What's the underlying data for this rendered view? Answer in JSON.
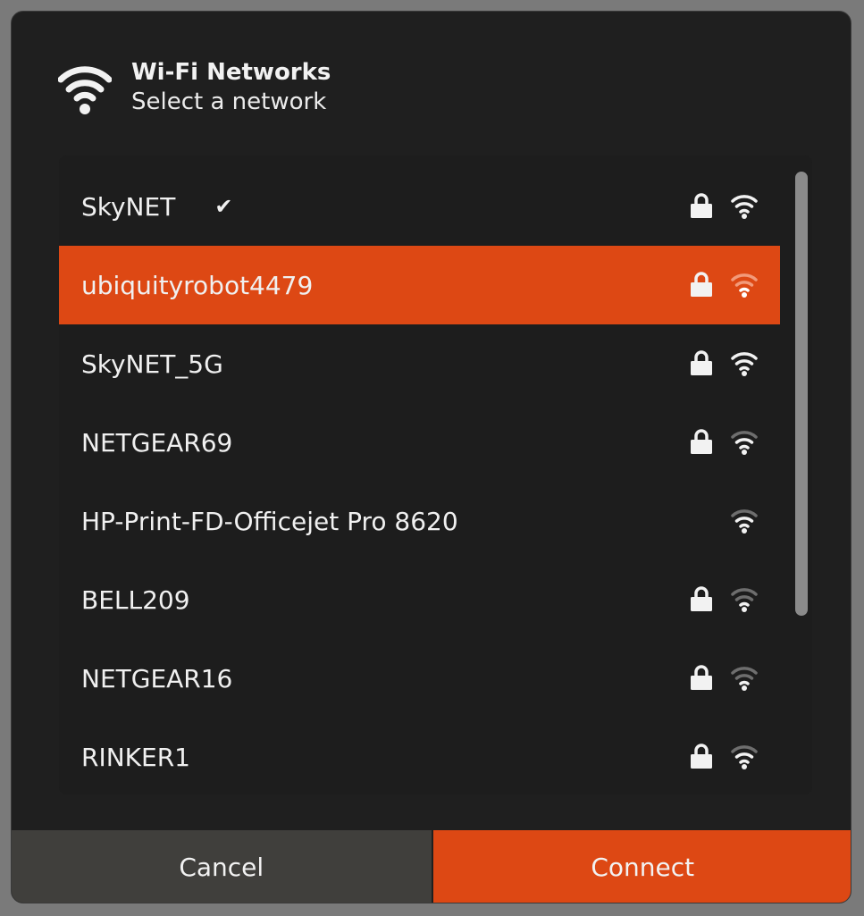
{
  "header": {
    "title": "Wi-Fi Networks",
    "subtitle": "Select a network",
    "icon": "wifi-icon"
  },
  "networks": [
    {
      "name": "SkyNET",
      "connected": true,
      "secured": true,
      "signal": 3,
      "selected": false
    },
    {
      "name": "ubiquityrobot4479",
      "connected": false,
      "secured": true,
      "signal": 1,
      "selected": true
    },
    {
      "name": "SkyNET_5G",
      "connected": false,
      "secured": true,
      "signal": 3,
      "selected": false
    },
    {
      "name": "NETGEAR69",
      "connected": false,
      "secured": true,
      "signal": 2,
      "selected": false
    },
    {
      "name": "HP-Print-FD-Officejet Pro 8620",
      "connected": false,
      "secured": false,
      "signal": 2,
      "selected": false
    },
    {
      "name": "BELL209",
      "connected": false,
      "secured": true,
      "signal": 1,
      "selected": false
    },
    {
      "name": "NETGEAR16",
      "connected": false,
      "secured": true,
      "signal": 1,
      "selected": false
    },
    {
      "name": "RINKER1",
      "connected": false,
      "secured": true,
      "signal": 2,
      "selected": false
    }
  ],
  "check_glyph": "✔",
  "buttons": {
    "cancel": "Cancel",
    "connect": "Connect"
  },
  "colors": {
    "accent": "#dd4814",
    "background": "#1f1f1f",
    "signal_on": "#f2f2f2",
    "signal_off": "#6e6e6e",
    "signal_on_selected": "#ffffff",
    "signal_off_selected": "#f29a7a"
  }
}
